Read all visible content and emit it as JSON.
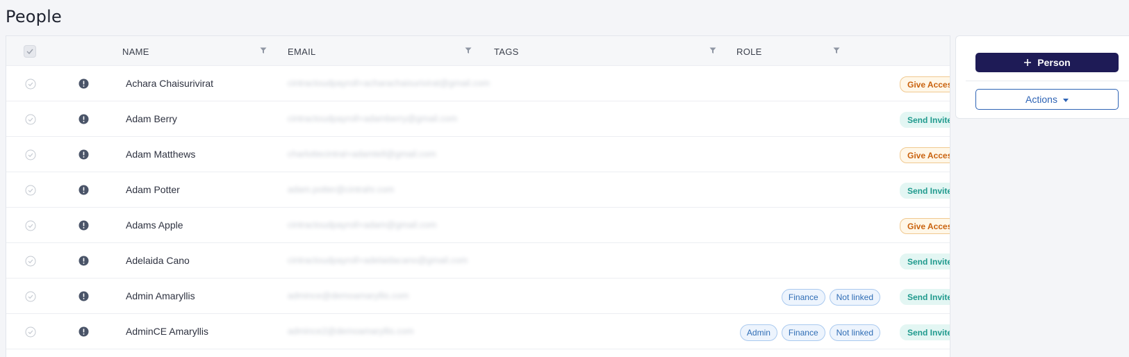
{
  "page": {
    "title": "People"
  },
  "table": {
    "columns": {
      "name": "NAME",
      "email": "EMAIL",
      "tags": "TAGS",
      "role": "ROLE"
    },
    "rows": [
      {
        "name": "Achara Chaisurivirat",
        "email": "cintractoudpayroll+acharachaisurivirat@gmail.com",
        "roles": [],
        "status": "Give Access",
        "status_type": "give"
      },
      {
        "name": "Adam Berry",
        "email": "cintractoudpayroll+adamberry@gmail.com",
        "roles": [],
        "status": "Send Invite",
        "status_type": "send"
      },
      {
        "name": "Adam Matthews",
        "email": "charlottecintral+adamtell@gmail.com",
        "roles": [],
        "status": "Give Access",
        "status_type": "give"
      },
      {
        "name": "Adam Potter",
        "email": "adam.potter@cintrahr.com",
        "roles": [],
        "status": "Send Invite",
        "status_type": "send"
      },
      {
        "name": "Adams Apple",
        "email": "cintractoudpayroll+adam@gmail.com",
        "roles": [],
        "status": "Give Access",
        "status_type": "give"
      },
      {
        "name": "Adelaida Cano",
        "email": "cintractoudpayroll+adelaidacano@gmail.com",
        "roles": [],
        "status": "Send Invite",
        "status_type": "send"
      },
      {
        "name": "Admin Amaryllis",
        "email": "admince@demoamaryllis.com",
        "roles": [
          "Finance",
          "Not linked"
        ],
        "status": "Send Invite",
        "status_type": "send"
      },
      {
        "name": "AdminCE Amaryllis",
        "email": "admince2@demoamaryllis.com",
        "roles": [
          "Admin",
          "Finance",
          "Not linked"
        ],
        "status": "Send Invite",
        "status_type": "send"
      }
    ]
  },
  "side_panel": {
    "add_person_label": "Person",
    "actions_label": "Actions"
  },
  "colors": {
    "primary": "#1e1b56",
    "link_blue": "#2d63b5",
    "give_access": "#c9620e",
    "send_invite": "#1f9a8d"
  },
  "icons": {
    "row_check": "circle-check-icon",
    "row_alert": "exclamation-circle-icon",
    "filter": "filter-icon",
    "plus": "plus-icon",
    "caret": "caret-down-icon"
  }
}
